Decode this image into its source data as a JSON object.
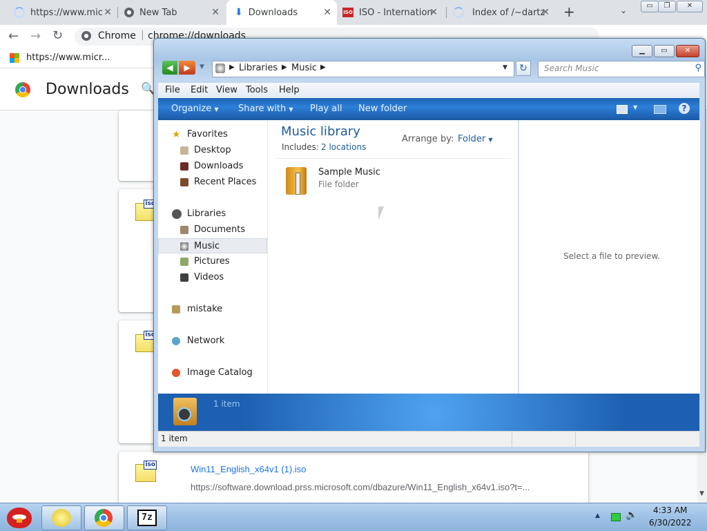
{
  "browser": {
    "tabs": [
      {
        "title": "https://www.mic"
      },
      {
        "title": "New Tab"
      },
      {
        "title": "Downloads"
      },
      {
        "title": "ISO - Internation"
      },
      {
        "title": "Index of /~dartz"
      }
    ],
    "new_tab_label": "+",
    "omnibox": {
      "chip": "Chrome",
      "url": "chrome://downloads"
    },
    "bookmark": "https://www.micr...",
    "page_title": "Downloads"
  },
  "downloads": {
    "item": {
      "file_name": "Win11_English_x64v1 (1).iso",
      "url": "https://software.download.prss.microsoft.com/dbazure/Win11_English_x64v1.iso?t=..."
    },
    "iso_badge": "iso"
  },
  "explorer": {
    "breadcrumb": [
      "Libraries",
      "Music"
    ],
    "search_placeholder": "Search Music",
    "menu": [
      "File",
      "Edit",
      "View",
      "Tools",
      "Help"
    ],
    "commands": [
      "Organize",
      "Share with",
      "Play all",
      "New folder"
    ],
    "nav": {
      "favorites": {
        "label": "Favorites",
        "items": [
          "Desktop",
          "Downloads",
          "Recent Places"
        ]
      },
      "libraries": {
        "label": "Libraries",
        "items": [
          "Documents",
          "Music",
          "Pictures",
          "Videos"
        ]
      },
      "homegroup": "mistake",
      "network": "Network",
      "catalog": "Image Catalog"
    },
    "library": {
      "title": "Music library",
      "includes_prefix": "Includes:",
      "includes_link": "2 locations",
      "arrange_label": "Arrange by:",
      "arrange_value": "Folder"
    },
    "folder": {
      "name": "Sample Music",
      "type": "File folder"
    },
    "preview_text": "Select a file to preview.",
    "details_count": "1 item",
    "status": "1 item"
  },
  "taskbar": {
    "clock_time": "4:33 AM",
    "clock_date": "6/30/2022",
    "zip_label": "7z"
  }
}
